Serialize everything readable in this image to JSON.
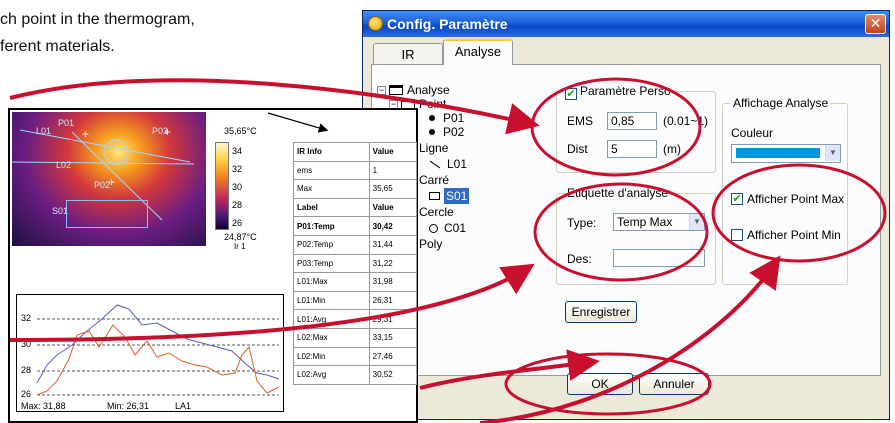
{
  "intro": {
    "line1": "ch point in the thermogram,",
    "line2": "ferent materials."
  },
  "dialog": {
    "title": "Config. Paramètre",
    "close_label": "✕",
    "tabs": [
      {
        "label": "IR"
      },
      {
        "label": "Analyse"
      }
    ],
    "tree": {
      "root": "Analyse",
      "point": "Point",
      "p01": "P01",
      "p02": "P02",
      "ligne": "Ligne",
      "l01": "L01",
      "carre": "Carré",
      "s01": "S01",
      "cercle": "Cercle",
      "c01": "C01",
      "poly": "Poly"
    },
    "param_perso": {
      "label": "Paramètre Perso",
      "checked": true,
      "ems_label": "EMS",
      "ems_value": "0,85",
      "ems_range": "(0.01~1)",
      "dist_label": "Dist",
      "dist_value": "5",
      "dist_unit": "(m)"
    },
    "etiquette": {
      "legend": "Etiquette d'analyse",
      "type_label": "Type:",
      "type_value": "Temp Max",
      "des_label": "Des:",
      "des_value": ""
    },
    "affichage": {
      "legend": "Affichage Analyse",
      "couleur_label": "Couleur",
      "color": "#0096e0",
      "point_max_label": "Afficher Point Max",
      "point_max_checked": true,
      "point_min_label": "Afficher Point Min",
      "point_min_checked": false
    },
    "enregistrer_label": "Enregistrer",
    "ok_label": "OK",
    "annuler_label": "Annuler"
  },
  "report": {
    "image_labels": {
      "l01": "L01",
      "p01": "P01",
      "p03": "P03",
      "l02": "L02",
      "p02": "P02",
      "s01": "S01"
    },
    "scale": {
      "max": "35,65°C",
      "min": "24,87°C",
      "ticks": [
        "34",
        "32",
        "30",
        "28",
        "26"
      ],
      "unit_label": "Ir 1"
    },
    "table": [
      [
        "IR Info",
        "Value"
      ],
      [
        "ems",
        "1"
      ],
      [
        "Max",
        "35,65"
      ],
      [
        "Label",
        "Value"
      ],
      [
        "P01:Temp",
        "30,42"
      ],
      [
        "P02:Temp",
        "31,44"
      ],
      [
        "P03:Temp",
        "31,22"
      ],
      [
        "L01:Max",
        "31,98"
      ],
      [
        "L01:Min",
        "26,31"
      ],
      [
        "L01:Avg",
        "29,31"
      ],
      [
        "L02:Max",
        "33,15"
      ],
      [
        "L02:Min",
        "27,46"
      ],
      [
        "L02:Avg",
        "30,52"
      ]
    ],
    "graph": {
      "y_ticks": [
        "32",
        "30",
        "28",
        "26"
      ],
      "max_text": "Max: 31,88",
      "min_text": "Min: 26,31",
      "line_label": "LA1"
    }
  },
  "colors": {
    "highlight_red": "#c8102e",
    "title_blue": "#0846c6",
    "dialog_bg": "#ece9d8"
  }
}
